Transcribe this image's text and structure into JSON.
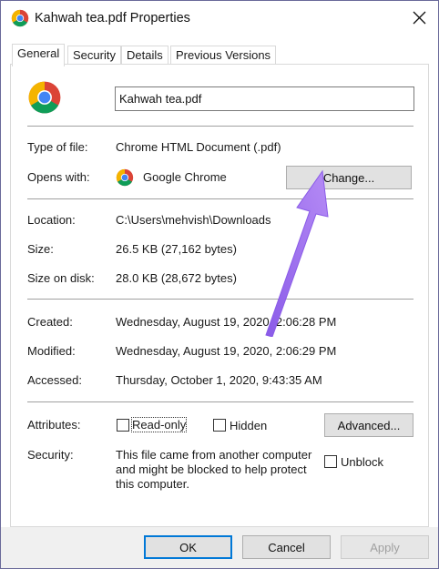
{
  "window": {
    "title": "Kahwah tea.pdf Properties",
    "icon": "chrome-icon"
  },
  "tabs": [
    {
      "label": "General",
      "active": true
    },
    {
      "label": "Security",
      "active": false
    },
    {
      "label": "Details",
      "active": false
    },
    {
      "label": "Previous Versions",
      "active": false
    }
  ],
  "general": {
    "file_name": "Kahwah tea.pdf",
    "type_label": "Type of file:",
    "type_value": "Chrome HTML Document (.pdf)",
    "opens_label": "Opens with:",
    "opens_value": "Google Chrome",
    "change_button": "Change...",
    "location_label": "Location:",
    "location_value": "C:\\Users\\mehvish\\Downloads",
    "size_label": "Size:",
    "size_value": "26.5 KB (27,162 bytes)",
    "size_disk_label": "Size on disk:",
    "size_disk_value": "28.0 KB (28,672 bytes)",
    "created_label": "Created:",
    "created_value": "Wednesday, August 19, 2020, 2:06:28 PM",
    "modified_label": "Modified:",
    "modified_value": "Wednesday, August 19, 2020, 2:06:29 PM",
    "accessed_label": "Accessed:",
    "accessed_value": "Thursday, October 1, 2020, 9:43:35 AM",
    "attributes_label": "Attributes:",
    "readonly_label": "Read-only",
    "readonly_checked": false,
    "hidden_label": "Hidden",
    "hidden_checked": false,
    "advanced_button": "Advanced...",
    "security_label": "Security:",
    "security_text_1": "This file came from another computer",
    "security_text_2": "and might be blocked to help protect",
    "security_text_3": "this computer.",
    "unblock_label": "Unblock",
    "unblock_checked": false
  },
  "footer": {
    "ok_button": "OK",
    "cancel_button": "Cancel",
    "apply_button": "Apply",
    "apply_enabled": false
  },
  "colors": {
    "accent_default_button": "#0078d7",
    "arrow_annotation": "#9b6cf0",
    "chrome_red": "#db4437",
    "chrome_yellow": "#f4b400",
    "chrome_green": "#0f9d58",
    "chrome_blue": "#4285f4"
  }
}
